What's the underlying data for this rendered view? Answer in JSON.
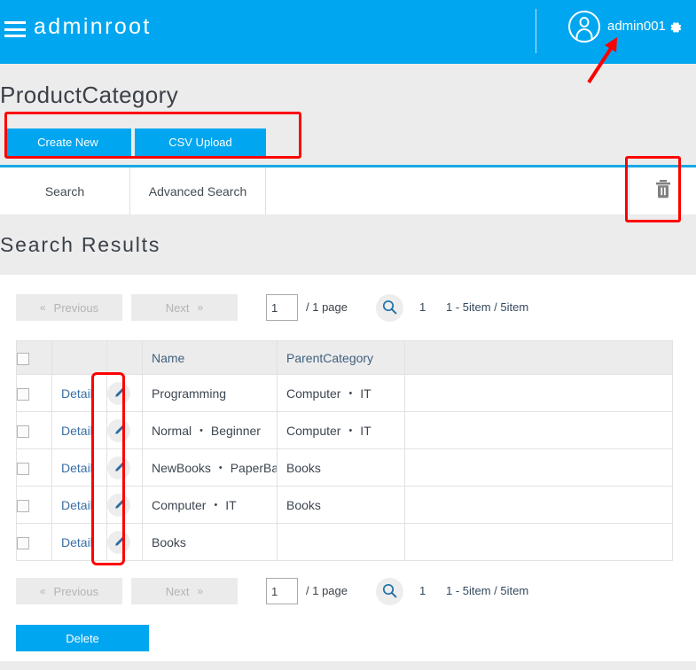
{
  "header": {
    "menu_icon": "hamburger-icon",
    "brand": "adminroot",
    "avatar_icon": "user-avatar-icon",
    "username": "admin001",
    "gear_icon": "gear-icon",
    "background_color": "#00a6ef"
  },
  "page": {
    "title": "ProductCategory",
    "create_new_label": "Create New",
    "csv_upload_label": "CSV Upload"
  },
  "tabs": {
    "items": [
      {
        "label": "Search"
      },
      {
        "label": "Advanced Search"
      }
    ],
    "trash_icon": "trash-icon"
  },
  "results": {
    "heading": "Search Results"
  },
  "pager": {
    "previous_label": "Previous",
    "previous_chevron": "«",
    "next_label": "Next",
    "next_chevron": "»",
    "page_value": "1",
    "page_total": "/ 1 page",
    "search_icon": "search-icon",
    "current_page": "1",
    "range": "1 - 5item / 5item"
  },
  "table": {
    "headers": {
      "check": "",
      "detail": "",
      "edit": "",
      "name": "Name",
      "parent": "ParentCategory",
      "rest": ""
    },
    "detail_label": "Detail",
    "edit_icon": "pencil-edit-icon",
    "rows": [
      {
        "detail": "Detail",
        "name": "Programming",
        "parent": "Computer ・ IT"
      },
      {
        "detail": "Detail",
        "name": "Normal ・ Beginner",
        "parent": "Computer ・ IT"
      },
      {
        "detail": "Detail",
        "name": "NewBooks ・ PaperBack",
        "parent": "Books"
      },
      {
        "detail": "Detail",
        "name": "Computer ・ IT",
        "parent": "Books"
      },
      {
        "detail": "Detail",
        "name": "Books",
        "parent": ""
      }
    ]
  },
  "footer": {
    "delete_label": "Delete"
  },
  "annotations": {
    "color": "#ff0000",
    "arrow_icon": "red-arrow-icon",
    "boxes": [
      "create-buttons",
      "trash-button",
      "edit-icon-column"
    ]
  },
  "colors": {
    "accent": "#00a6ef",
    "tab_underline": "#19a9e5",
    "page_background": "#ececec",
    "panel_background": "#ffffff",
    "link": "#3a6fa5",
    "annotation": "#ff0000"
  }
}
